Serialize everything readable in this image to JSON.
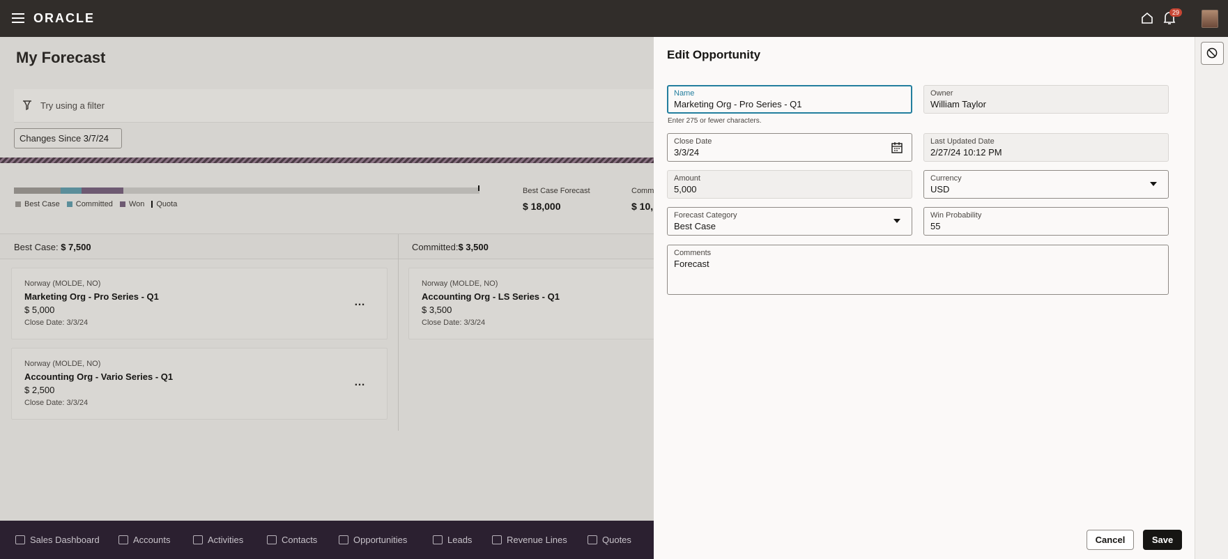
{
  "header": {
    "logo": "ORACLE",
    "notification_count": "29"
  },
  "page": {
    "title": "My Forecast",
    "filter_placeholder": "Try using a filter",
    "changes_since_label": "Changes Since",
    "changes_since_date": "3/7/24",
    "legend": {
      "best_case": "Best Case",
      "committed": "Committed",
      "won": "Won",
      "quota": "Quota"
    },
    "colors": {
      "best_case": "#8f8b86",
      "committed": "#5b8e9a",
      "won": "#6e5a72"
    },
    "progress": {
      "best_case_fraction": 0.1,
      "committed_fraction": 0.045,
      "won_fraction": 0.09
    },
    "kpis": [
      {
        "label": "Best Case Forecast",
        "value": "$ 18,000"
      },
      {
        "label": "Comm",
        "value": "$ 10,"
      }
    ],
    "columns": [
      {
        "label": "Best Case:",
        "amount": "$ 7,500"
      },
      {
        "label": "Committed:",
        "amount": "$ 3,500"
      }
    ],
    "cards": [
      {
        "location": "Norway (MOLDE, NO)",
        "name": "Marketing Org - Pro Series - Q1",
        "amount": "$ 5,000",
        "close_date": "Close Date: 3/3/24"
      },
      {
        "location": "Norway (MOLDE, NO)",
        "name": "Accounting Org - Vario Series - Q1",
        "amount": "$ 2,500",
        "close_date": "Close Date: 3/3/24"
      },
      {
        "location": "Norway (MOLDE, NO)",
        "name": "Accounting Org - LS Series - Q1",
        "amount": "$ 3,500",
        "close_date": "Close Date: 3/3/24"
      }
    ],
    "more_label": "…"
  },
  "bottom_nav": [
    {
      "label": "Sales Dashboard",
      "icon": "dashboard-icon"
    },
    {
      "label": "Accounts",
      "icon": "accounts-icon"
    },
    {
      "label": "Activities",
      "icon": "activities-icon"
    },
    {
      "label": "Contacts",
      "icon": "contacts-icon"
    },
    {
      "label": "Opportunities",
      "icon": "opportunities-icon"
    },
    {
      "label": "Leads",
      "icon": "leads-icon"
    },
    {
      "label": "Revenue Lines",
      "icon": "revenue-lines-icon"
    },
    {
      "label": "Quotes",
      "icon": "quotes-icon"
    }
  ],
  "drawer": {
    "title": "Edit Opportunity",
    "name": {
      "label": "Name",
      "value": "Marketing Org - Pro Series - Q1"
    },
    "name_hint": "Enter 275 or fewer characters.",
    "owner": {
      "label": "Owner",
      "value": "William Taylor"
    },
    "close_date": {
      "label": "Close Date",
      "value": "3/3/24"
    },
    "last_updated": {
      "label": "Last Updated Date",
      "value": "2/27/24 10:12 PM"
    },
    "amount": {
      "label": "Amount",
      "value": "5,000"
    },
    "currency": {
      "label": "Currency",
      "value": "USD"
    },
    "forecast_category": {
      "label": "Forecast Category",
      "value": "Best Case"
    },
    "win_probability": {
      "label": "Win Probability",
      "value": "55"
    },
    "comments": {
      "label": "Comments",
      "value": "Forecast"
    },
    "cancel_label": "Cancel",
    "save_label": "Save"
  }
}
